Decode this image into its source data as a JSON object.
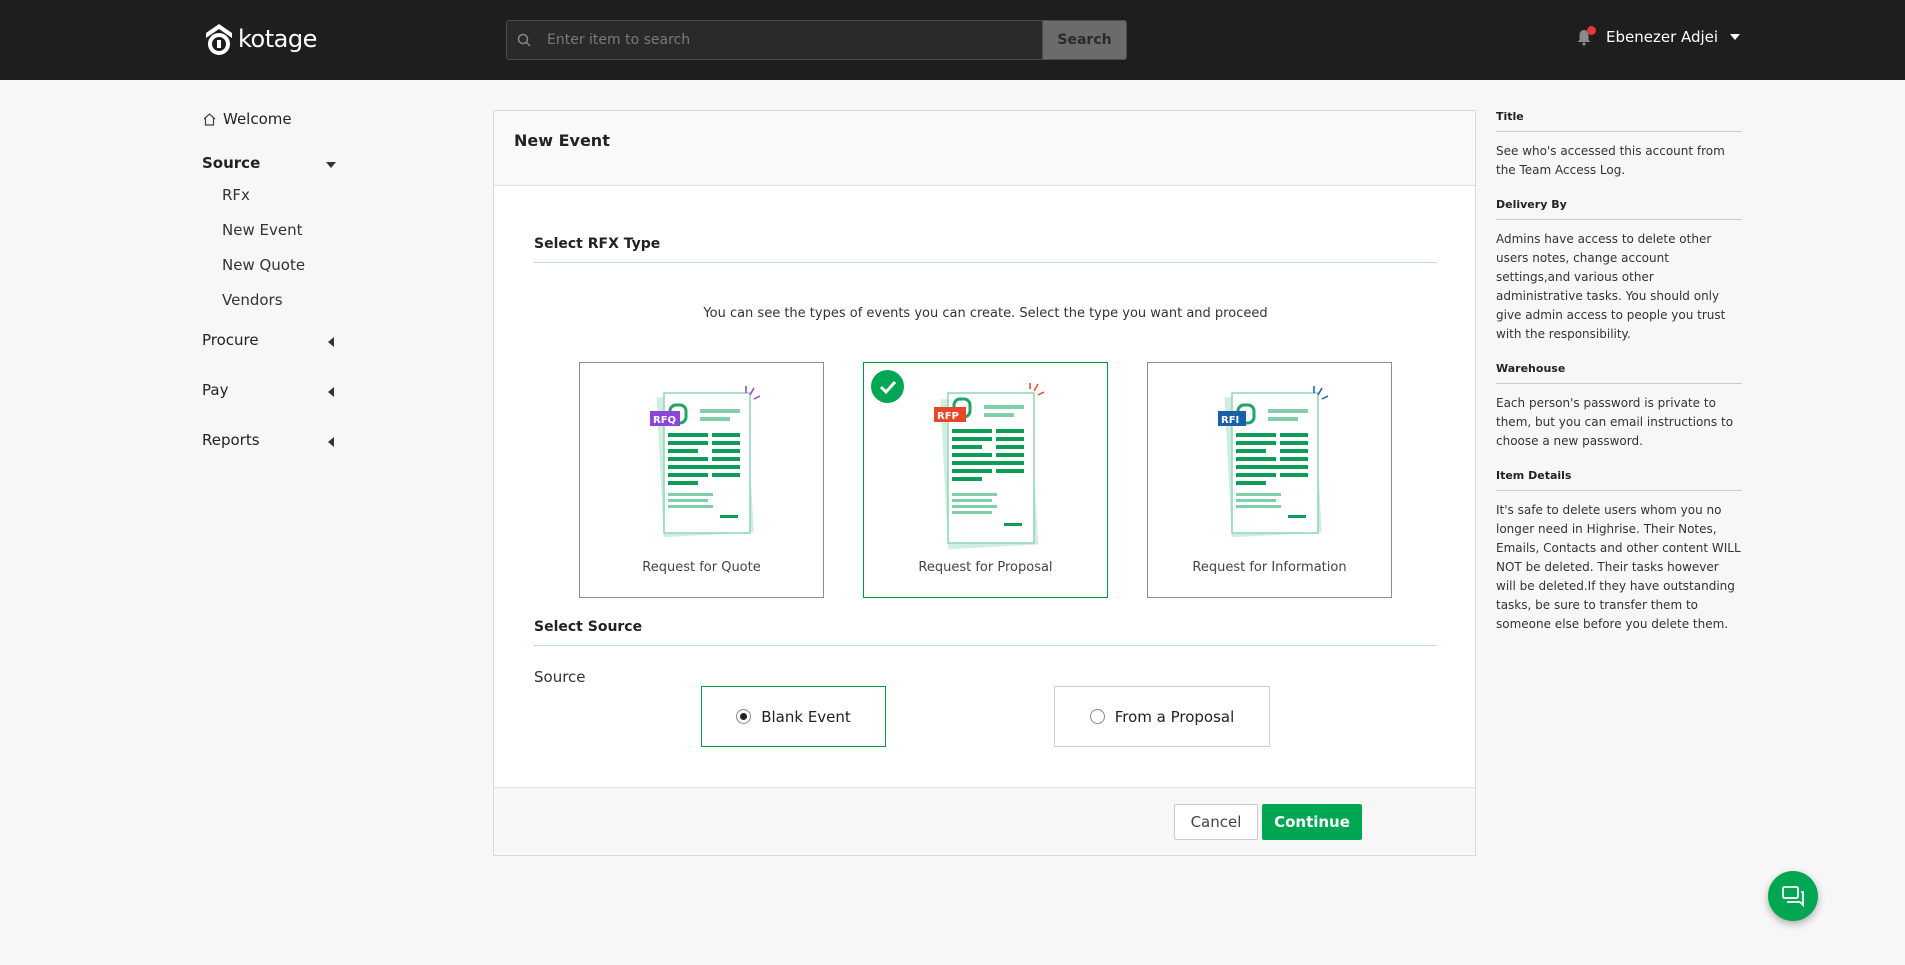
{
  "app": {
    "brand": "kotage"
  },
  "topbar": {
    "search_placeholder": "Enter item to search",
    "search_button": "Search",
    "user_name": "Ebenezer Adjei"
  },
  "sidebar": {
    "welcome": "Welcome",
    "source": "Source",
    "source_items": [
      "RFx",
      "New Event",
      "New Quote",
      "Vendors"
    ],
    "procure": "Procure",
    "pay": "Pay",
    "reports": "Reports"
  },
  "main": {
    "title": "New Event",
    "rfx_section": "Select RFX Type",
    "hint": "You can see the types of events you can create. Select the type you want and proceed",
    "rfx_types": [
      {
        "tag": "RFQ",
        "label": "Request for Quote",
        "tag_color": "#8e44d6",
        "selected": false
      },
      {
        "tag": "RFP",
        "label": "Request for Proposal",
        "tag_color": "#e8462a",
        "selected": true
      },
      {
        "tag": "RFI",
        "label": "Request for Information",
        "tag_color": "#1a5fa8",
        "selected": false
      }
    ],
    "source_section": "Select Source",
    "source_label": "Source",
    "source_options": [
      {
        "label": "Blank Event",
        "selected": true
      },
      {
        "label": "From a Proposal",
        "selected": false
      }
    ],
    "cancel": "Cancel",
    "continue": "Continue"
  },
  "info_panel": [
    {
      "title": "Title",
      "body": "See who's accessed this account from the Team Access Log."
    },
    {
      "title": "Delivery By",
      "body": "Admins have access to delete other users notes, change account settings,and various other administrative tasks. You should only give admin access to people you trust with the responsibility."
    },
    {
      "title": "Warehouse",
      "body": "Each person's password is private to them, but you can email instructions to choose a new password."
    },
    {
      "title": "Item Details",
      "body": "It's safe to delete users whom you no longer need in Highrise. Their Notes, Emails, Contacts and other content WILL NOT be deleted. Their tasks however will be deleted.If they have outstanding tasks, be sure to transfer them to someone else before you delete them."
    }
  ],
  "colors": {
    "accent": "#00a651",
    "topbar": "#1e1e1e"
  },
  "icons": [
    "search-icon",
    "bell-icon",
    "home-icon",
    "chat-icon",
    "check-icon"
  ]
}
